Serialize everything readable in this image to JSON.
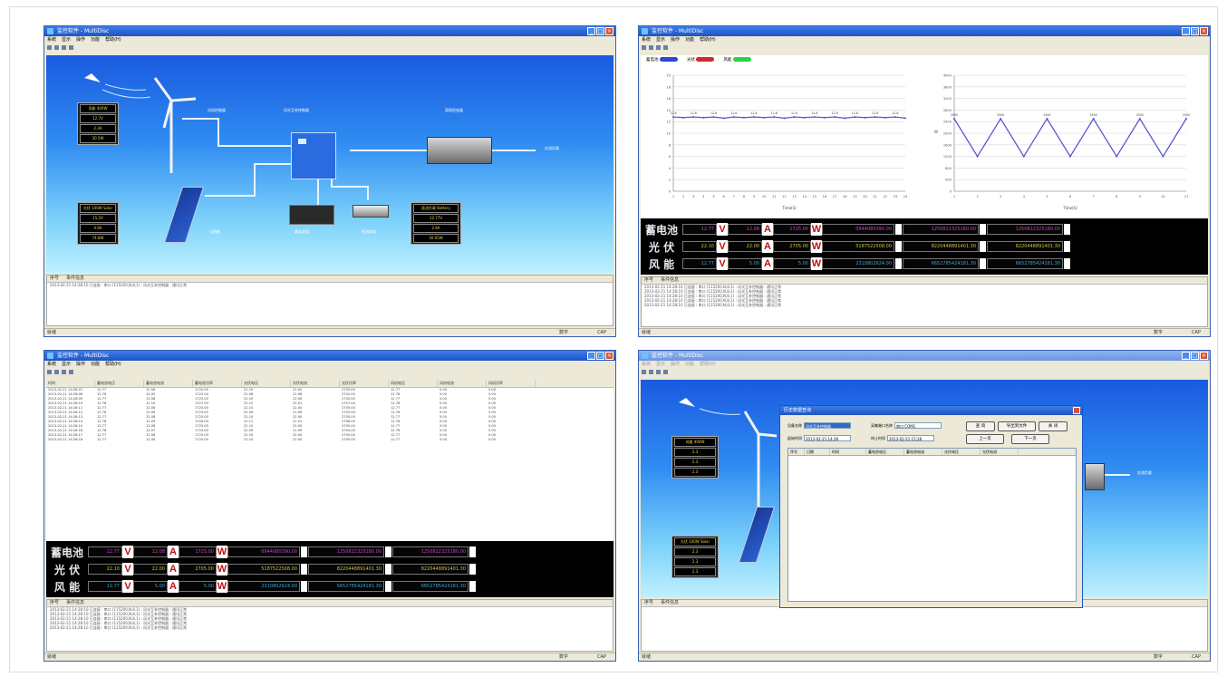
{
  "app": {
    "title": "监控软件 - MultiDisc",
    "menu": [
      "系统",
      "显示",
      "操作",
      "功能",
      "帮助(H)"
    ]
  },
  "status": {
    "left": "就绪",
    "mid": "数字",
    "right": "CAP"
  },
  "log": {
    "col1": "序号",
    "col2": "事件信息",
    "line": "2013-02-21 14:28:10  已连接 : 串口 (115200,N,8,1) : 风光互补控制器 : 通讯正常"
  },
  "scene": {
    "wind_label": "风机控制器",
    "controller_label": "风光互补控制器",
    "inverter_label": "离网逆变器",
    "ac_label": "交流负载",
    "pv_label": "太阳能",
    "battery_label": "蓄电池组",
    "dc_label": "直流负载",
    "wind_box": [
      "风能 400W",
      "12.7V",
      "2.3A",
      "30.5W"
    ],
    "pv_box": [
      "光伏 100W Solar",
      "15.2V",
      "4.9A",
      "74.8W"
    ],
    "load_box": [
      "直流负载 Battery",
      "12.77V",
      "2.4A",
      "30.65W"
    ]
  },
  "chart_legend": [
    "蓄电池",
    "光伏",
    "风能"
  ],
  "chart_data": [
    {
      "type": "line",
      "title": "",
      "xlabel": "Time(S)",
      "ylabel": "",
      "x": [
        1,
        2,
        3,
        4,
        5,
        6,
        7,
        8,
        9,
        10,
        11,
        12,
        13,
        14,
        15,
        16,
        17,
        18,
        19,
        20,
        21,
        22,
        23,
        24
      ],
      "series": [
        {
          "name": "蓄电池",
          "values": [
            12.8,
            12.7,
            12.8,
            12.7,
            12.8,
            12.6,
            12.8,
            12.7,
            12.8,
            12.7,
            12.8,
            12.6,
            12.8,
            12.7,
            12.8,
            12.7,
            12.8,
            12.6,
            12.8,
            12.7,
            12.8,
            12.7,
            12.8,
            12.6
          ]
        }
      ],
      "ylim": [
        0,
        20
      ],
      "color": "#5050d0"
    },
    {
      "type": "line",
      "title": "",
      "xlabel": "Time(S)",
      "ylabel": "W",
      "x": [
        1,
        2,
        3,
        4,
        5,
        6,
        7,
        8,
        9,
        10,
        11
      ],
      "series": [
        {
          "name": "",
          "values": [
            2500,
            1200,
            2500,
            1200,
            2500,
            1200,
            2500,
            1200,
            2500,
            1200,
            2500
          ]
        }
      ],
      "ylim": [
        0,
        4000
      ],
      "color": "#5050d0"
    }
  ],
  "meters": [
    {
      "name": "蓄电池",
      "v": "12.77",
      "a": "12.08",
      "w": "1725.00",
      "e1": "0944080390.00",
      "e2": "1250822325180.00",
      "e3": "1250822325180.00",
      "color": "#d23fd2"
    },
    {
      "name": "光 伏",
      "v": "22.10",
      "a": "22.00",
      "w": "2705.00",
      "e1": "5187522508.00",
      "e2": "8220448891401.30",
      "e3": "8220448891401.30",
      "color": "#d2c23f"
    },
    {
      "name": "风 能",
      "v": "12.77",
      "a": "5.00",
      "w": "5.00",
      "e1": "2310802624.00",
      "e2": "6652785424181.30",
      "e3": "6652785424181.30",
      "color": "#3fa6d2"
    }
  ],
  "units": {
    "v": "V",
    "a": "A",
    "w": "W"
  },
  "grid": {
    "headers": [
      "时间",
      "蓄电池电压",
      "蓄电池电流",
      "蓄电池功率",
      "光伏电压",
      "光伏电流",
      "光伏功率",
      "风机电压",
      "风机电流",
      "风机功率"
    ],
    "rows": [
      [
        "2013-02-21 14:28:07",
        "12.77",
        "12.08",
        "1725.00",
        "22.10",
        "22.00",
        "2705.00",
        "12.77",
        "5.00",
        "5.00"
      ],
      [
        "2013-02-21 14:28:08",
        "12.76",
        "12.05",
        "1722.00",
        "22.08",
        "21.98",
        "2702.00",
        "12.76",
        "5.00",
        "5.00"
      ],
      [
        "2013-02-21 14:28:09",
        "12.77",
        "12.08",
        "1725.00",
        "22.10",
        "22.00",
        "2705.00",
        "12.77",
        "5.00",
        "5.00"
      ],
      [
        "2013-02-21 14:28:10",
        "12.78",
        "12.10",
        "1727.00",
        "22.12",
        "22.01",
        "2707.00",
        "12.78",
        "5.00",
        "5.00"
      ],
      [
        "2013-02-21 14:28:11",
        "12.77",
        "12.08",
        "1725.00",
        "22.10",
        "22.00",
        "2705.00",
        "12.77",
        "5.00",
        "5.00"
      ],
      [
        "2013-02-21 14:28:12",
        "12.76",
        "12.06",
        "1723.00",
        "22.09",
        "21.99",
        "2703.00",
        "12.76",
        "5.00",
        "5.00"
      ],
      [
        "2013-02-21 14:28:13",
        "12.77",
        "12.08",
        "1725.00",
        "22.10",
        "22.00",
        "2705.00",
        "12.77",
        "5.00",
        "5.00"
      ],
      [
        "2013-02-21 14:28:14",
        "12.78",
        "12.09",
        "1726.00",
        "22.11",
        "22.01",
        "2706.00",
        "12.78",
        "5.00",
        "5.00"
      ],
      [
        "2013-02-21 14:28:15",
        "12.77",
        "12.08",
        "1725.00",
        "22.10",
        "22.00",
        "2705.00",
        "12.77",
        "5.00",
        "5.00"
      ],
      [
        "2013-02-21 14:28:16",
        "12.76",
        "12.07",
        "1724.00",
        "22.09",
        "21.99",
        "2704.00",
        "12.76",
        "5.00",
        "5.00"
      ],
      [
        "2013-02-21 14:28:17",
        "12.77",
        "12.08",
        "1725.00",
        "22.10",
        "22.00",
        "2705.00",
        "12.77",
        "5.00",
        "5.00"
      ],
      [
        "2013-02-21 14:28:18",
        "12.77",
        "12.08",
        "1725.00",
        "22.10",
        "22.00",
        "2705.00",
        "12.77",
        "5.00",
        "5.00"
      ]
    ]
  },
  "dialog": {
    "title": "历史数据查询",
    "device_label": "设备名称",
    "device_value": "风光互补控制器",
    "port_label": "采集端口名称",
    "port_value": "串口 COM1",
    "start_label": "起始时间",
    "start_value": "2013-02-21 14:28",
    "end_label": "终止时间",
    "end_value": "2013-02-21 15:28",
    "query": "查 询",
    "export": "导出到文件",
    "close": "关 闭",
    "prev": "上一页",
    "next": "下一页",
    "cols": [
      "序号",
      "日期",
      "时间",
      "蓄电池电压",
      "蓄电池电流",
      "光伏电压",
      "光伏电流"
    ]
  },
  "scene4": {
    "box1": [
      "风能 400W",
      "2.3",
      "2.3",
      "2.3"
    ],
    "box2": [
      "光伏 100W Solar",
      "2.3",
      "2.3",
      "2.3"
    ],
    "ac_label": "交流负载"
  }
}
